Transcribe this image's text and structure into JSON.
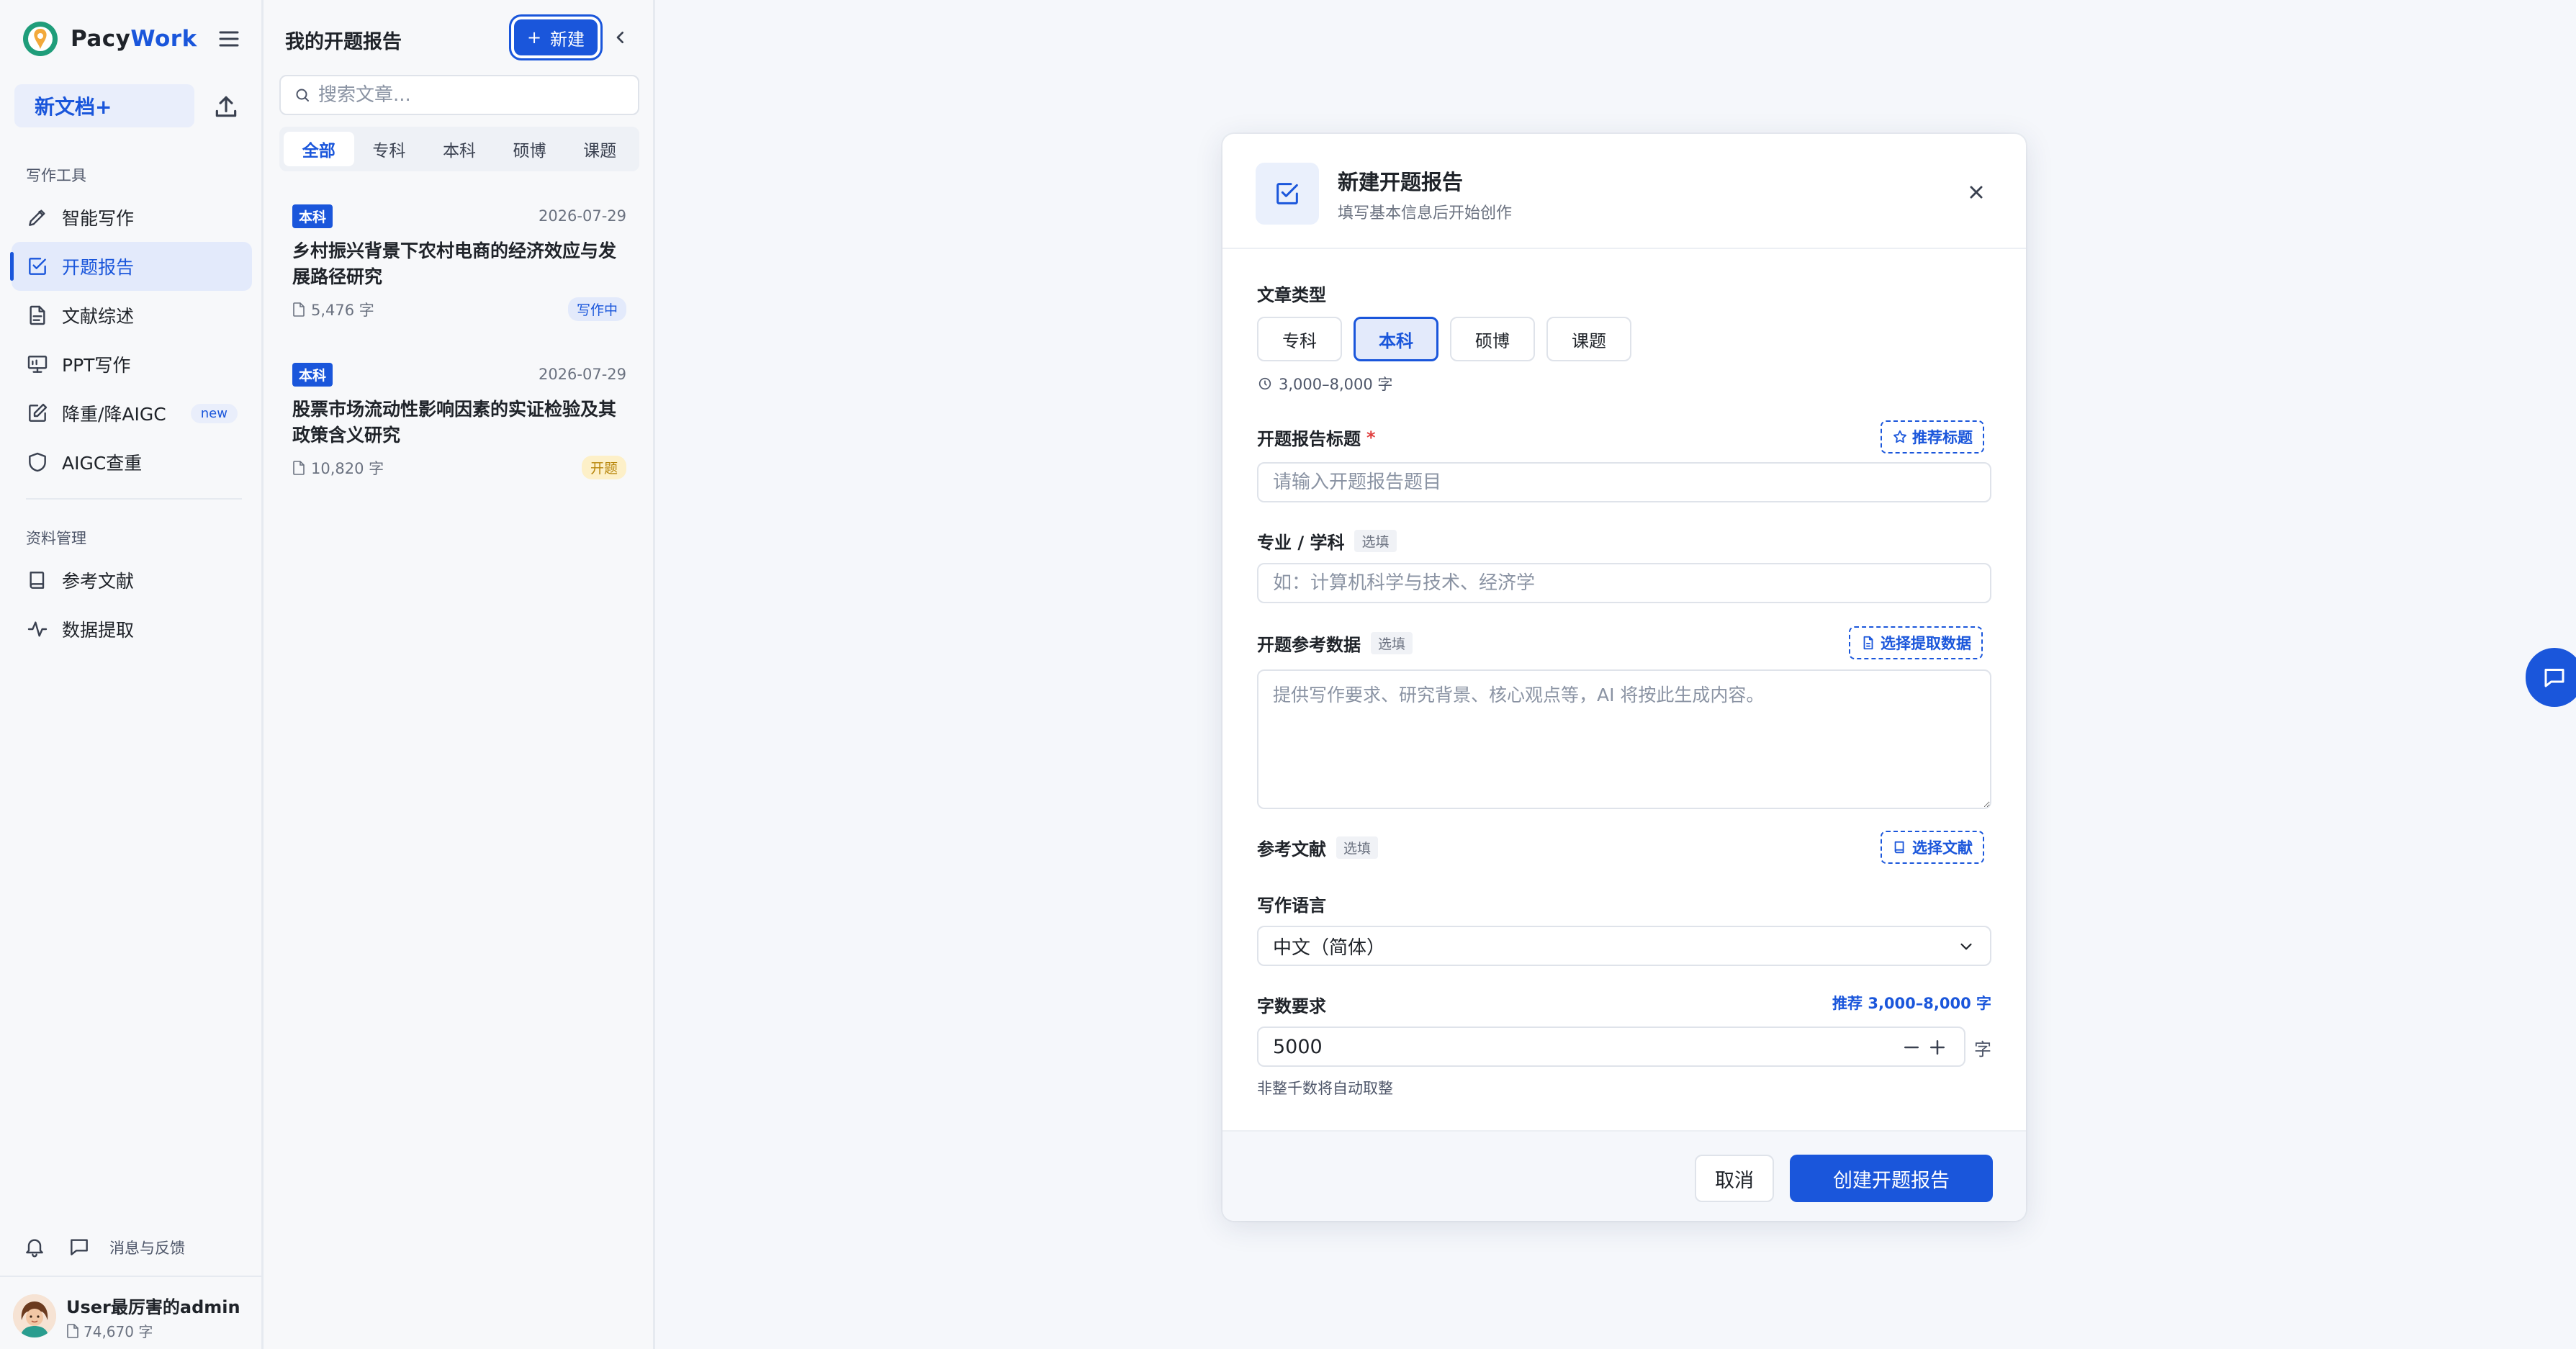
{
  "brand": {
    "name_prefix": "Pacy",
    "name_suffix": "Work"
  },
  "sidebar": {
    "new_doc_label": "新文档+",
    "section_tools": "写作工具",
    "tools": [
      {
        "label": "智能写作",
        "icon": "pencil-icon"
      },
      {
        "label": "开题报告",
        "icon": "checkbox-icon"
      },
      {
        "label": "文献综述",
        "icon": "document-icon"
      },
      {
        "label": "PPT写作",
        "icon": "presentation-icon"
      },
      {
        "label": "降重/降AIGC",
        "icon": "edit-icon",
        "badge": "new"
      },
      {
        "label": "AIGC查重",
        "icon": "shield-icon"
      }
    ],
    "section_resources": "资料管理",
    "resources": [
      {
        "label": "参考文献",
        "icon": "book-icon"
      },
      {
        "label": "数据提取",
        "icon": "activity-icon"
      }
    ],
    "feedback_label": "消息与反馈",
    "user": {
      "name": "User最厉害的admin",
      "words": "74,670 字"
    }
  },
  "doc_panel": {
    "title": "我的开题报告",
    "new_button": "新建",
    "search_placeholder": "搜索文章...",
    "filters": [
      "全部",
      "专科",
      "本科",
      "硕博",
      "课题"
    ],
    "documents": [
      {
        "level": "本科",
        "date": "2026-07-29",
        "title_line1": "乡村振兴背景下农村电商的经济效应与发",
        "title_line2": "展路径研究",
        "words": "5,476 字",
        "status": "写作中"
      },
      {
        "level": "本科",
        "date": "2026-07-29",
        "title_line1": "股票市场流动性影响因素的实证检验及其",
        "title_line2": "政策含义研究",
        "words": "10,820 字",
        "status": "开题"
      }
    ]
  },
  "modal": {
    "title": "新建开题报告",
    "subtitle": "填写基本信息后开始创作",
    "type_label": "文章类型",
    "types": [
      "专科",
      "本科",
      "硕博",
      "课题"
    ],
    "selected_type": "本科",
    "range_hint": "3,000–8,000 字",
    "title_label": "开题报告标题",
    "required_mark": "*",
    "recommend_title_btn": "推荐标题",
    "title_placeholder": "请输入开题报告题目",
    "major_label": "专业 / 学科",
    "optional_tag": "选填",
    "major_placeholder": "如：计算机科学与技术、经济学",
    "ref_data_label": "开题参考数据",
    "select_data_btn": "选择提取数据",
    "ref_data_placeholder": "提供写作要求、研究背景、核心观点等，AI 将按此生成内容。",
    "references_label": "参考文献",
    "select_refs_btn": "选择文献",
    "language_label": "写作语言",
    "language_value": "中文（简体）",
    "word_count_label": "字数要求",
    "word_count_recommend": "推荐 3,000–8,000 字",
    "word_count_value": "5000",
    "unit": "字",
    "round_hint": "非整千数将自动取整",
    "cancel_btn": "取消",
    "create_btn": "创建开题报告"
  },
  "colors": {
    "accent": "#1a56db",
    "required": "#e03e3e",
    "status_open": "#b8860b"
  }
}
